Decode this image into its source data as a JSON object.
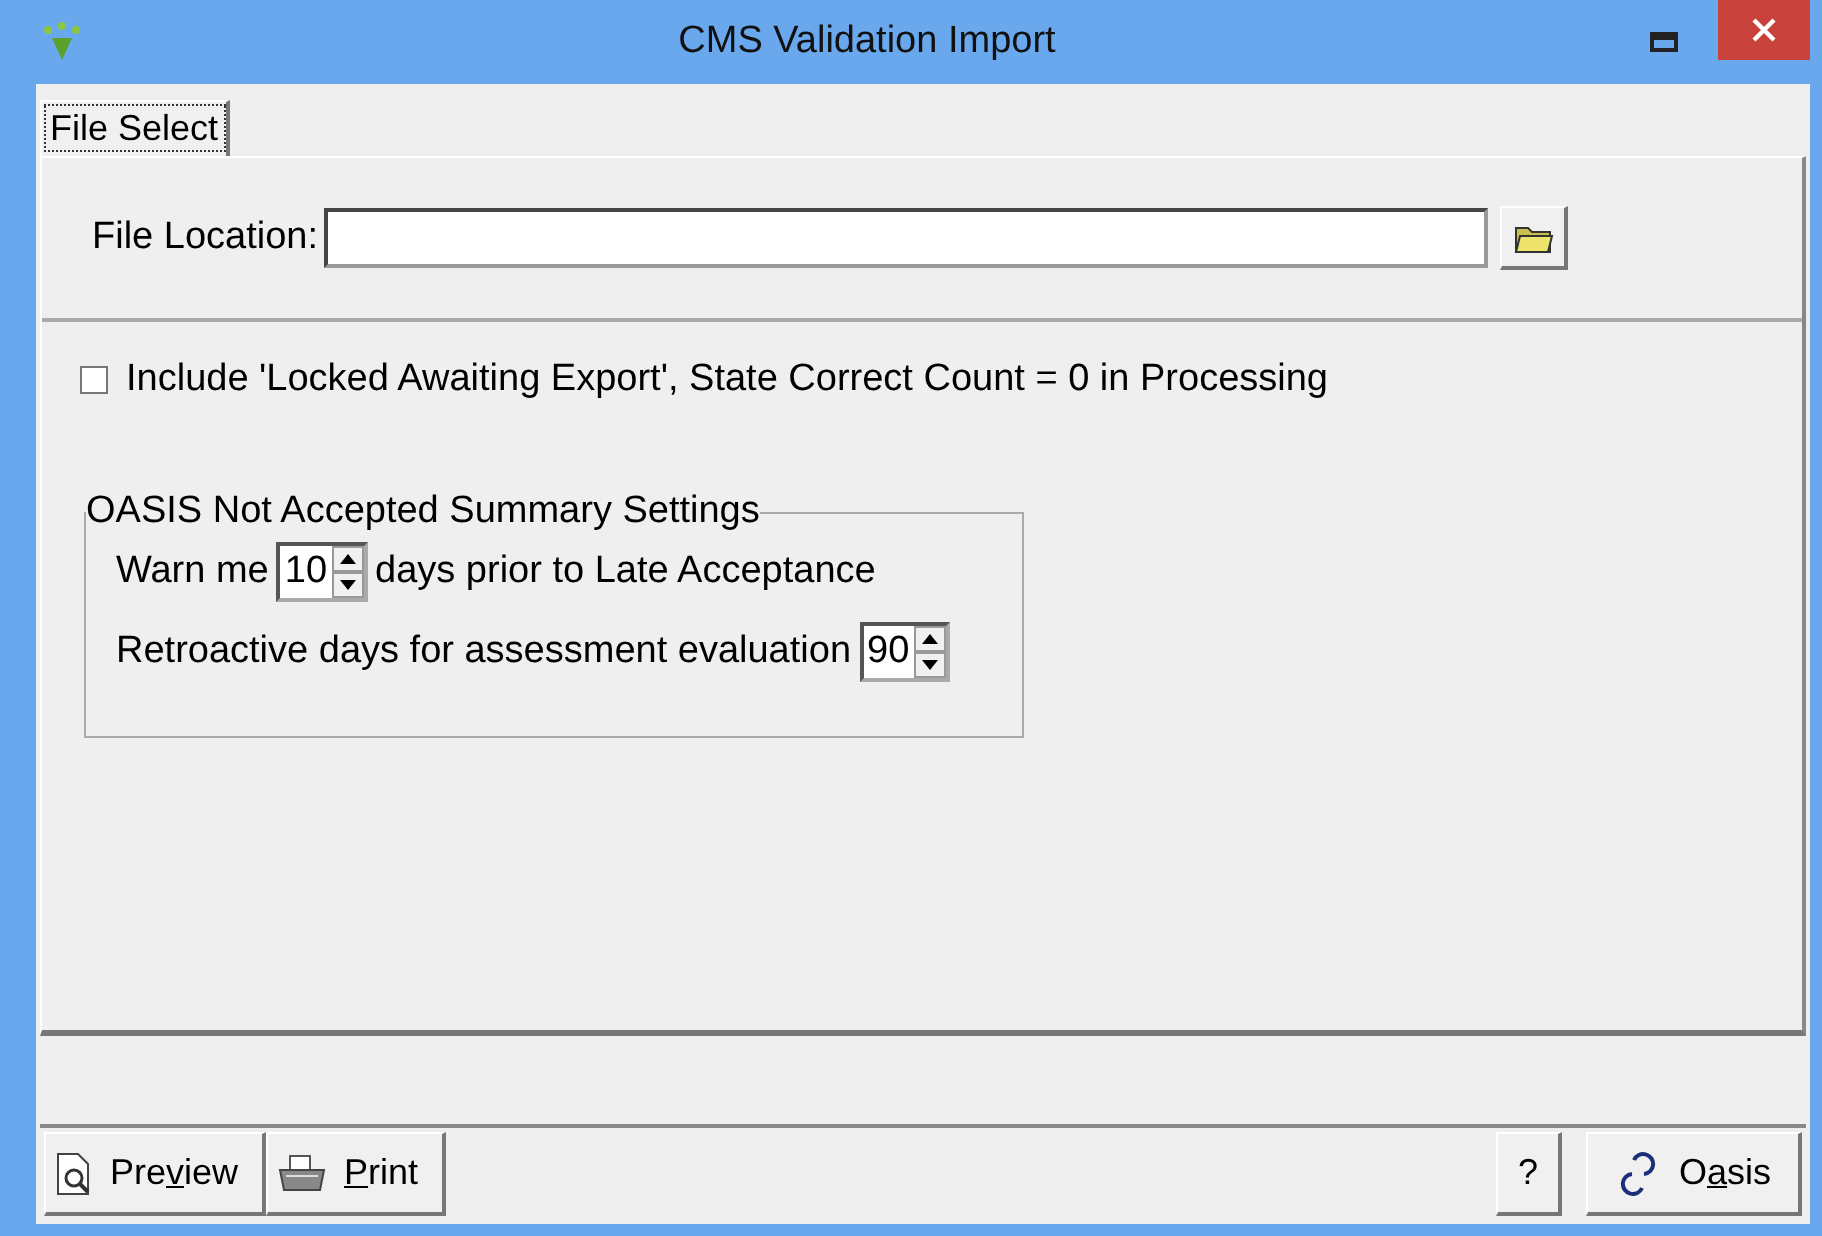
{
  "window": {
    "title": "CMS Validation Import"
  },
  "tabs": [
    {
      "label": "File Select",
      "selected": true
    }
  ],
  "file_location": {
    "label": "File Location:"
  },
  "include_locked": {
    "label": "Include 'Locked Awaiting Export', State Correct Count = 0 in Processing",
    "checked": false
  },
  "summary_settings": {
    "title": "OASIS Not Accepted Summary Settings",
    "warn": {
      "before": "Warn me",
      "value": "10",
      "after": "days prior to Late Acceptance"
    },
    "retroactive": {
      "before": "Retroactive days for assessment evaluation",
      "value": "90"
    }
  },
  "buttons_left": [
    {
      "kind": "preview",
      "before": "Pre",
      "underlined": "v",
      "after": "iew"
    },
    {
      "kind": "print",
      "underlined": "P",
      "after": "rint"
    }
  ],
  "buttons_right": [
    {
      "kind": "help",
      "label": "?"
    },
    {
      "kind": "oasis",
      "before": "O",
      "underlined": "a",
      "after": "sis"
    }
  ]
}
